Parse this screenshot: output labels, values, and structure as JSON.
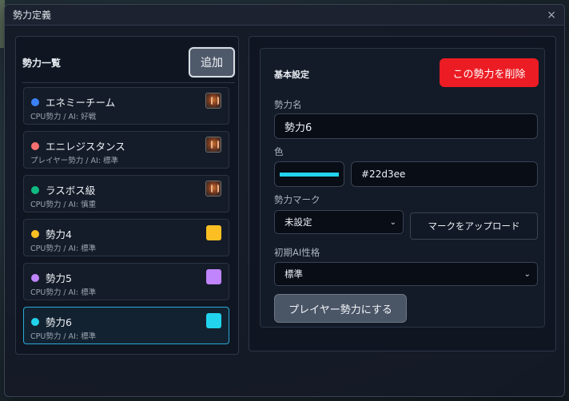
{
  "window": {
    "title": "勢力定義",
    "close_label": "×"
  },
  "list_panel": {
    "title": "勢力一覧",
    "add_label": "追加",
    "factions": [
      {
        "name": "エネミーチーム",
        "sub": "CPU勢力 / AI: 好戦",
        "dot_color": "#3b82f6",
        "mark": "emblem"
      },
      {
        "name": "エニレジスタンス",
        "sub": "プレイヤー勢力 / AI: 標準",
        "dot_color": "#f87171",
        "mark": "emblem"
      },
      {
        "name": "ラスボス級",
        "sub": "CPU勢力 / AI: 慎重",
        "dot_color": "#10b981",
        "mark": "emblem"
      },
      {
        "name": "勢力4",
        "sub": "CPU勢力 / AI: 標準",
        "dot_color": "#fbbf24",
        "swatch_color": "#fbbf24"
      },
      {
        "name": "勢力5",
        "sub": "CPU勢力 / AI: 標準",
        "dot_color": "#c084fc",
        "swatch_color": "#c084fc"
      },
      {
        "name": "勢力6",
        "sub": "CPU勢力 / AI: 標準",
        "dot_color": "#22d3ee",
        "swatch_color": "#22d3ee",
        "selected": true
      }
    ]
  },
  "settings": {
    "section_title": "基本設定",
    "delete_label": "この勢力を削除",
    "name_label": "勢力名",
    "name_value": "勢力6",
    "color_label": "色",
    "color_value": "#22d3ee",
    "mark_label": "勢力マーク",
    "mark_value": "未設定",
    "upload_label": "マークをアップロード",
    "ai_label": "初期AI性格",
    "ai_value": "標準",
    "player_button_label": "プレイヤー勢力にする"
  },
  "colors": {
    "accent": "#22d3ee",
    "danger": "#ec1c24",
    "selected_border": "#2aaad6"
  }
}
